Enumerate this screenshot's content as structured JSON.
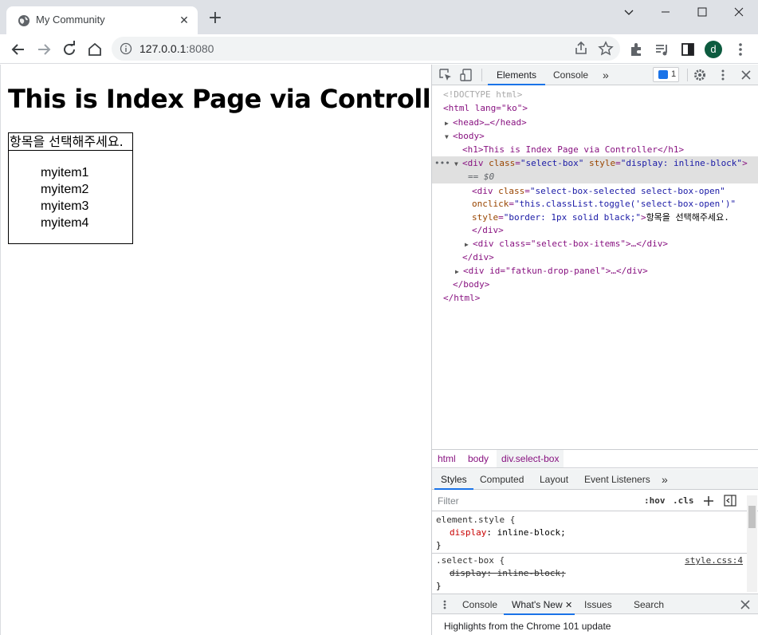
{
  "browser": {
    "tab_title": "My Community",
    "tab_close": "✕",
    "new_tab": "+",
    "url_host": "127.0.0.1",
    "url_port": ":8080",
    "avatar_letter": "d"
  },
  "page": {
    "heading": "This is Index Page via Controller",
    "select_label": "항목을 선택해주세요.",
    "items": [
      "myitem1",
      "myitem2",
      "myitem3",
      "myitem4"
    ]
  },
  "devtools": {
    "tabs": [
      "Elements",
      "Console"
    ],
    "message_count": "1",
    "dom": {
      "doctype": "<!DOCTYPE html>",
      "html_open": "<html lang=\"ko\">",
      "head": "<head>…</head>",
      "body_open": "<body>",
      "h1": "<h1>This is Index Page via Controller</h1>",
      "selected_div_tag": "<div",
      "selected_div_attr1": "class",
      "selected_div_val1": "\"select-box\"",
      "selected_div_attr2": "style",
      "selected_div_val2": "\"display: inline-block\"",
      "selected_marker": "== $0",
      "inner_div_line1_tag": "<div",
      "inner_div_line1_attr": "class",
      "inner_div_line1_val": "\"select-box-selected select-box-open\"",
      "inner_div_line2_attr": "onclick",
      "inner_div_line2_val": "\"this.classList.toggle('select-box-open')\"",
      "inner_div_line3_attr": "style",
      "inner_div_line3_val": "\"border: 1px solid black;\"",
      "inner_div_line3_text": "항목을 선택해주세요.",
      "inner_div_close": "</div>",
      "items_div": "<div class=\"select-box-items\">…</div>",
      "div_close": "</div>",
      "fatkun_div": "<div id=\"fatkun-drop-panel\">…</div>",
      "body_close": "</body>",
      "html_close": "</html>"
    },
    "breadcrumbs": [
      "html",
      "body",
      "div.select-box"
    ],
    "style_tabs": [
      "Styles",
      "Computed",
      "Layout",
      "Event Listeners"
    ],
    "filter_placeholder": "Filter",
    "hov": ":hov",
    "cls": ".cls",
    "rules": {
      "element_style_selector": "element.style {",
      "element_style_prop": "display",
      "element_style_value": "inline-block;",
      "close_brace": "}",
      "select_box_selector": ".select-box {",
      "select_box_source": "style.css:4",
      "select_box_prop": "display: inline-block;"
    },
    "drawer_tabs": [
      "Console",
      "What's New",
      "Issues",
      "Search"
    ],
    "drawer_text": "Highlights from the Chrome 101 update"
  }
}
